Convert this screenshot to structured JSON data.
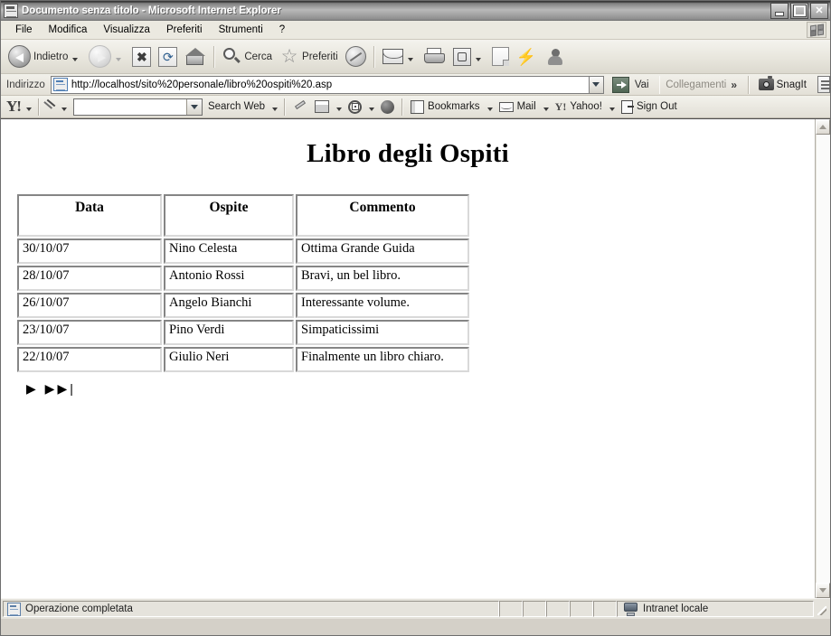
{
  "window": {
    "title": "Documento senza titolo - Microsoft Internet Explorer",
    "title_icon": "ie-page-icon",
    "minimize_label": "_",
    "maximize_label": "□",
    "close_label": "✕"
  },
  "menu": {
    "items": [
      {
        "label": "File"
      },
      {
        "label": "Modifica"
      },
      {
        "label": "Visualizza"
      },
      {
        "label": "Preferiti"
      },
      {
        "label": "Strumenti"
      },
      {
        "label": "?"
      }
    ],
    "brand_icon": "windows-flag-icon"
  },
  "toolbar": {
    "back_label": "Indietro",
    "forward_label": "",
    "search_label": "Cerca",
    "favorites_label": "Preferiti",
    "icons": [
      "back-arrow-icon",
      "forward-arrow-icon",
      "stop-icon",
      "refresh-icon",
      "home-icon",
      "search-magnifier-icon",
      "favorites-star-icon",
      "history-icon",
      "mail-icon",
      "print-icon",
      "edit-icon",
      "note-icon",
      "discuss-icon",
      "messenger-icon"
    ]
  },
  "address": {
    "label": "Indirizzo",
    "url": "http://localhost/sito%20personale/libro%20ospiti%20.asp",
    "page_icon": "ie-page-icon",
    "dropdown_icon": "chevron-down-icon",
    "go_label": "Vai",
    "links_label": "Collegamenti",
    "more_chevron": "»",
    "snagit_label": "SnagIt",
    "snagit_icon": "camera-icon",
    "snagit_capture_icon": "snagit-capture-icon"
  },
  "yahoo_toolbar": {
    "logo": "Y!",
    "pencil_icon": "pencil-icon",
    "search_value": "",
    "search_placeholder": "",
    "search_web_label": "Search Web",
    "highlighter_icon": "highlighter-icon",
    "popup_blocker_icon": "popup-blocker-icon",
    "anti_spy_icon": "anti-spy-icon",
    "media_icon": "media-circle-icon",
    "bookmarks_label": "Bookmarks",
    "bookmarks_icon": "bookmarks-icon",
    "mail_label": "Mail",
    "mail_icon": "envelope-icon",
    "yahoo_label": "Yahoo!",
    "yahoo_icon": "yahoo-y-icon",
    "signout_label": "Sign Out",
    "signout_icon": "sign-out-door-icon"
  },
  "page": {
    "heading": "Libro degli Ospiti",
    "table": {
      "columns": [
        "Data",
        "Ospite",
        "Commento"
      ],
      "rows": [
        {
          "data": "30/10/07",
          "ospite": "Nino Celesta",
          "commento": "Ottima Grande Guida"
        },
        {
          "data": "28/10/07",
          "ospite": "Antonio Rossi",
          "commento": "Bravi, un bel libro."
        },
        {
          "data": "26/10/07",
          "ospite": "Angelo Bianchi",
          "commento": "Interessante volume."
        },
        {
          "data": "23/10/07",
          "ospite": "Pino Verdi",
          "commento": "Simpaticissimi"
        },
        {
          "data": "22/10/07",
          "ospite": "Giulio Neri",
          "commento": "Finalmente un libro chiaro."
        }
      ]
    },
    "pager": {
      "next_label": "▶",
      "last_label": "▶▶|"
    }
  },
  "scrollbar": {
    "up_icon": "scroll-up-arrow-icon",
    "down_icon": "scroll-down-arrow-icon"
  },
  "statusbar": {
    "status_text": "Operazione completata",
    "status_icon": "ie-page-icon",
    "zone_text": "Intranet locale",
    "zone_icon": "local-intranet-icon",
    "resize_grip": "resize-grip-icon"
  }
}
